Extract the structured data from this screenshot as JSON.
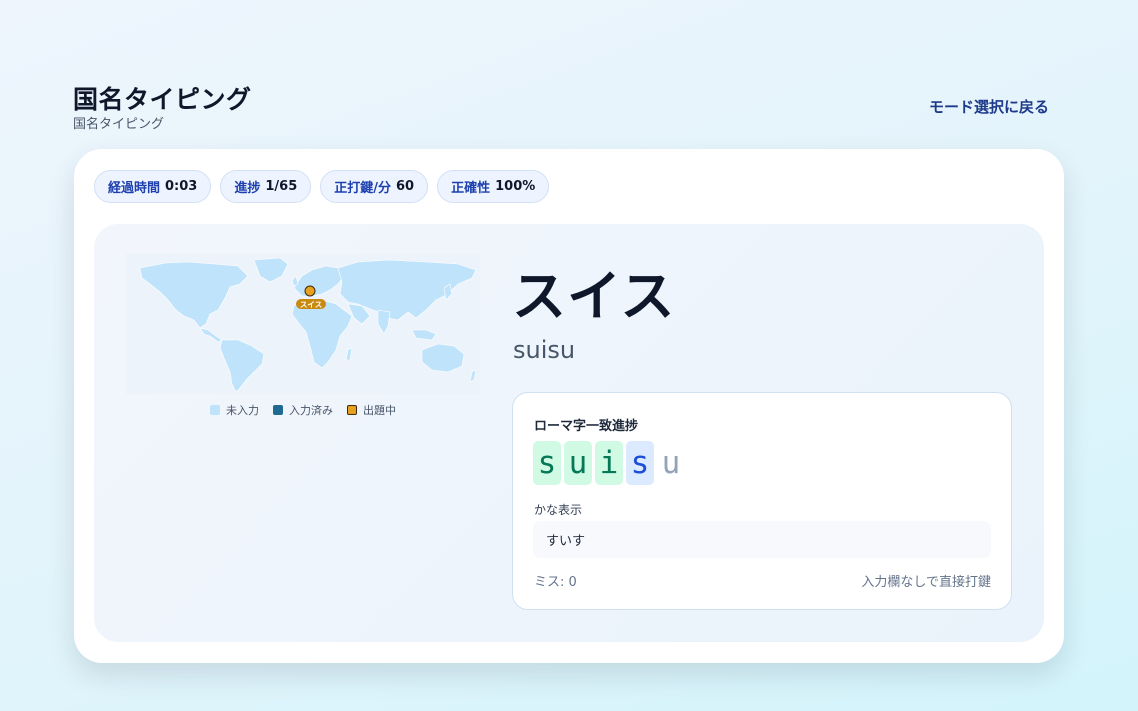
{
  "header": {
    "title": "国名タイピング",
    "subtitle": "国名タイピング",
    "back_label": "モード選択に戻る"
  },
  "stats": [
    {
      "label": "経過時間",
      "value": "0:03"
    },
    {
      "label": "進捗",
      "value": "1/65"
    },
    {
      "label": "正打鍵/分",
      "value": "60"
    },
    {
      "label": "正確性",
      "value": "100%"
    }
  ],
  "map": {
    "marker_label": "スイス",
    "legend": [
      {
        "label": "未入力",
        "color": "#bfe3fb"
      },
      {
        "label": "入力済み",
        "color": "#1f6a93"
      },
      {
        "label": "出題中",
        "color": "#e8a020"
      }
    ]
  },
  "question": {
    "country": "スイス",
    "romaji": "suisu"
  },
  "progress": {
    "title": "ローマ字一致進捗",
    "chars": [
      {
        "char": "s",
        "state": "done"
      },
      {
        "char": "u",
        "state": "done"
      },
      {
        "char": "i",
        "state": "done"
      },
      {
        "char": "s",
        "state": "current"
      },
      {
        "char": "u",
        "state": "pending"
      }
    ],
    "kana_label": "かな表示",
    "kana_value": "すいす",
    "miss_text": "ミス: 0",
    "hint_text": "入力欄なしで直接打鍵"
  },
  "colors": {
    "accent": "#1e40af",
    "done": "#047857",
    "current": "#1d4ed8",
    "pending": "#94a3b8",
    "marker": "#e8a020"
  }
}
